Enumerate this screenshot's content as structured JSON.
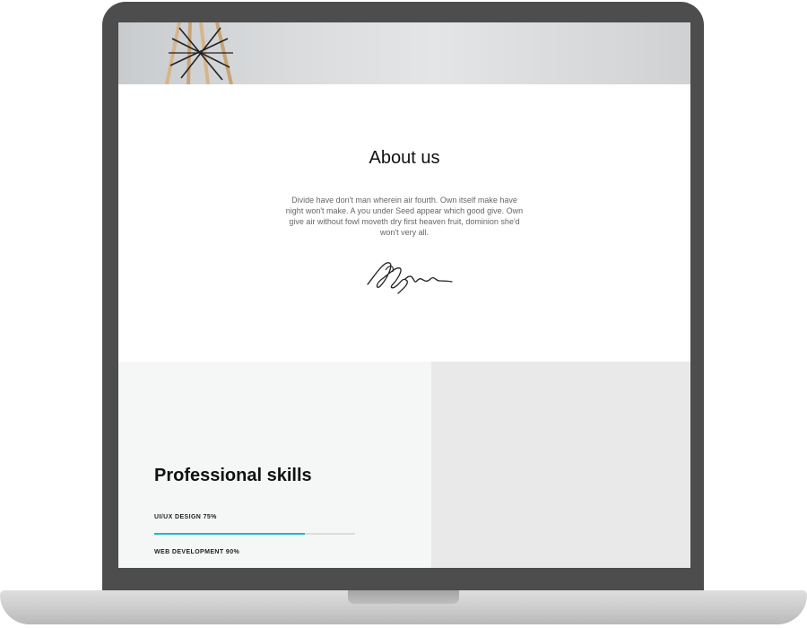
{
  "about": {
    "title": "About us",
    "text": "Divide have don't man wherein air fourth. Own itself make have night won't make. A you under Seed appear which good give. Own give air without fowl moveth dry first heaven fruit, dominion she'd won't very all."
  },
  "skills": {
    "title": "Professional skills",
    "items": [
      {
        "label": "UI/UX DESIGN 75%",
        "percent": 75
      },
      {
        "label": "WEB DEVELOPMENT 90%",
        "percent": 90
      }
    ]
  },
  "colors": {
    "accent": "#1fb7cc",
    "bezel": "#4d4d4d",
    "skills_panel_bg": "#f5f7f6",
    "right_panel_bg": "#e9e9e9"
  }
}
